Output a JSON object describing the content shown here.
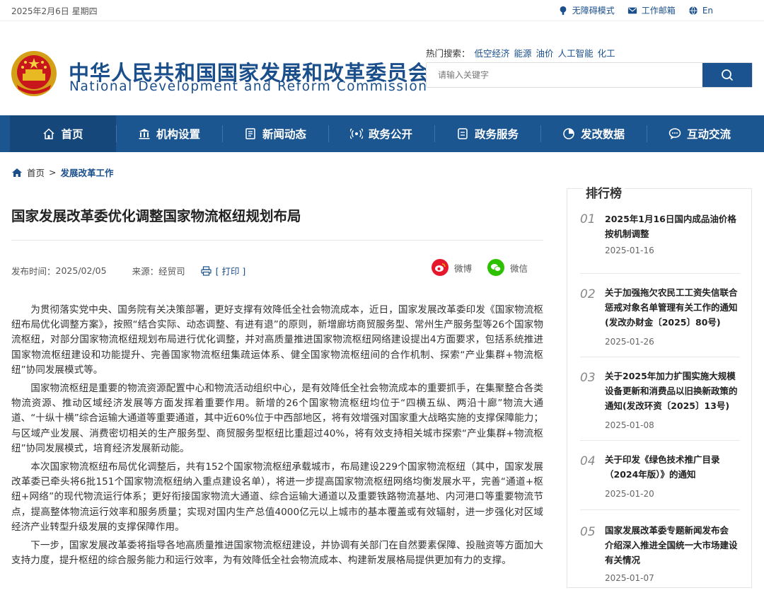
{
  "topbar": {
    "date": "2025年2月6日 星期四",
    "links": [
      {
        "label": "无障碍模式",
        "icon": "accessibility-icon"
      },
      {
        "label": "工作邮箱",
        "icon": "mail-icon"
      },
      {
        "label": "En",
        "icon": "globe-icon"
      }
    ]
  },
  "header": {
    "title_zh": "中华人民共和国国家发展和改革委员会",
    "title_en": "National Development and Reform Commission",
    "hot_label": "热门搜索：",
    "hot_keywords": [
      "低空经济",
      "能源",
      "油价",
      "人工智能",
      "化工"
    ],
    "search_placeholder": "请输入关键字"
  },
  "nav": [
    {
      "label": "首页",
      "icon": "home-icon"
    },
    {
      "label": "机构设置",
      "icon": "building-icon"
    },
    {
      "label": "新闻动态",
      "icon": "news-icon"
    },
    {
      "label": "政务公开",
      "icon": "broadcast-icon"
    },
    {
      "label": "政务服务",
      "icon": "document-icon"
    },
    {
      "label": "发改数据",
      "icon": "pie-chart-icon"
    },
    {
      "label": "互动交流",
      "icon": "chat-icon"
    }
  ],
  "breadcrumb": {
    "home": "首页",
    "sep": ">",
    "current": "发展改革工作"
  },
  "article": {
    "title": "国家发展改革委优化调整国家物流枢纽规划布局",
    "publish_label": "发布时间：",
    "publish_date": "2025/02/05",
    "source_label": "来源：",
    "source": "经贸司",
    "print_label": "[ 打印 ]",
    "share_weibo": "微博",
    "share_wechat": "微信",
    "paragraphs": [
      "为贯彻落实党中央、国务院有关决策部署，更好支撑有效降低全社会物流成本，近日，国家发展改革委印发《国家物流枢纽布局优化调整方案》，按照“结合实际、动态调整、有进有退”的原则，新增廊坊商贸服务型、常州生产服务型等26个国家物流枢纽，对部分国家物流枢纽规划布局进行优化调整，并对高质量推进国家物流枢纽网络建设提出4方面要求，包括系统推进国家物流枢纽建设和功能提升、完善国家物流枢纽集疏运体系、健全国家物流枢纽间的合作机制、探索“产业集群+物流枢纽”协同发展模式等。",
      "国家物流枢纽是重要的物流资源配置中心和物流活动组织中心，是有效降低全社会物流成本的重要抓手，在集聚整合各类物流资源、推动区域经济发展等方面发挥着重要作用。新增的26个国家物流枢纽均位于“四横五纵、两沿十廊”物流大通道、“十纵十横”综合运输大通道等重要通道，其中近60%位于中西部地区，将有效增强对国家重大战略实施的支撑保障能力；与区域产业发展、消费密切相关的生产服务型、商贸服务型枢纽比重超过40%，将有效支持相关城市探索“产业集群+物流枢纽”协同发展模式，培育经济发展新动能。",
      "本次国家物流枢纽布局优化调整后，共有152个国家物流枢纽承载城市，布局建设229个国家物流枢纽（其中，国家发展改革委已牵头将6批151个国家物流枢纽纳入重点建设名单），将进一步提高国家物流枢纽网络均衡发展水平，完善“通道+枢纽+网络”的现代物流运行体系；更好衔接国家物流大通道、综合运输大通道以及重要铁路物流基地、内河港口等重要物流节点，提高整体物流运行效率和服务质量；实现对国内生产总值4000亿元以上城市的基本覆盖或有效辐射，进一步强化对区域经济产业转型升级发展的支撑保障作用。",
      "下一步，国家发展改革委将指导各地高质量推进国家物流枢纽建设，并协调有关部门在自然要素保障、投融资等方面加大支持力度，提升枢纽的综合服务能力和运行效率，为有效降低全社会物流成本、构建新发展格局提供更加有力的支撑。"
    ]
  },
  "ranking": {
    "title": "排行榜",
    "items": [
      {
        "num": "01",
        "title": "2025年1月16日国内成品油价格按机制调整",
        "date": "2025-01-16"
      },
      {
        "num": "02",
        "title": "关于加强拖欠农民工工资失信联合惩戒对象名单管理有关工作的通知(发改办财金〔2025〕80号)",
        "date": "2025-01-26"
      },
      {
        "num": "03",
        "title": "关于2025年加力扩围实施大规模设备更新和消费品以旧换新政策的通知(发改环资〔2025〕13号)",
        "date": "2025-01-08"
      },
      {
        "num": "04",
        "title": "关于印发《绿色技术推广目录（2024年版）》的通知",
        "date": "2025-01-20"
      },
      {
        "num": "05",
        "title": "国家发展改革委专题新闻发布会 介绍深入推进全国统一大市场建设有关情况",
        "date": "2025-01-07"
      }
    ]
  },
  "colors": {
    "brand_blue": "#1c5690",
    "nav_active": "#15477a",
    "weibo_red": "#e6162d",
    "wechat_green": "#2dc100"
  }
}
